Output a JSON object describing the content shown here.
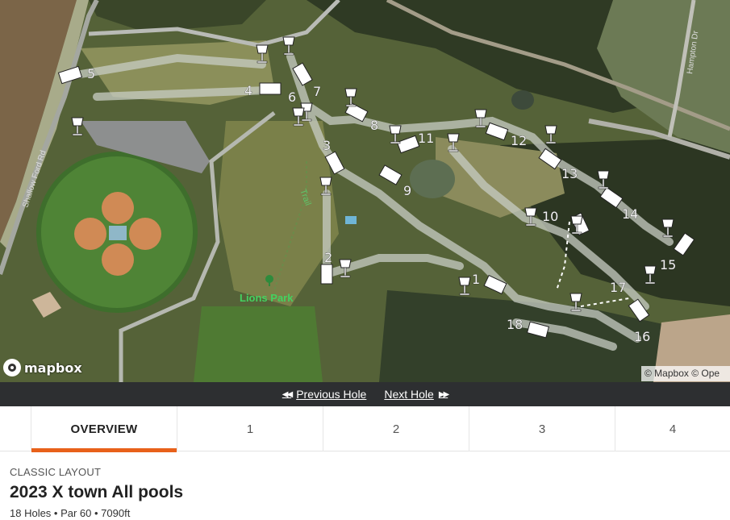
{
  "map": {
    "park_label": "Lions Park",
    "trail_label": "Trail",
    "road_left": "Shallow Ford Rd",
    "road_right": "Hampton Dr",
    "logo_text": "mapbox",
    "attribution": "© Mapbox © Ope",
    "hole_labels": [
      "1",
      "2",
      "3",
      "4",
      "5",
      "6",
      "7",
      "8",
      "9",
      "10",
      "11",
      "12",
      "13",
      "14",
      "15",
      "16",
      "17",
      "18"
    ],
    "colors": {
      "tee": "#ffffff",
      "basket": "#ffffff",
      "fairway_path": "#c8cdc4",
      "park_label": "#44d160"
    }
  },
  "navbar": {
    "prev_label": "Previous Hole",
    "next_label": "Next Hole",
    "prev_icon": "double-left-triangle-icon",
    "next_icon": "double-right-triangle-icon"
  },
  "tabs": [
    "OVERVIEW",
    "1",
    "2",
    "3",
    "4"
  ],
  "active_tab": "OVERVIEW",
  "course": {
    "layout_label": "CLASSIC LAYOUT",
    "title": "2023 X town All pools",
    "meta": "18 Holes • Par 60 • 7090ft"
  },
  "accent_color": "#e8611a"
}
